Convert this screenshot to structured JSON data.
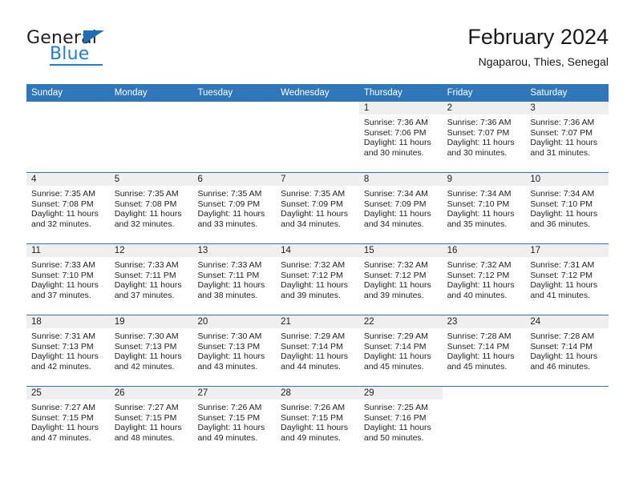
{
  "brand": {
    "name_top": "General",
    "name_bottom": "Blue",
    "accent_color": "#2f76bb",
    "logo_blue": "#1f7fd0"
  },
  "header": {
    "title": "February 2024",
    "subtitle": "Ngaparou, Thies, Senegal"
  },
  "calendar": {
    "weekdays": [
      "Sunday",
      "Monday",
      "Tuesday",
      "Wednesday",
      "Thursday",
      "Friday",
      "Saturday"
    ],
    "weeks": [
      [
        {
          "date": "",
          "blank": true,
          "sunrise": "",
          "sunset": "",
          "daylight_line1": "",
          "daylight_line2": ""
        },
        {
          "date": "",
          "blank": true,
          "sunrise": "",
          "sunset": "",
          "daylight_line1": "",
          "daylight_line2": ""
        },
        {
          "date": "",
          "blank": true,
          "sunrise": "",
          "sunset": "",
          "daylight_line1": "",
          "daylight_line2": ""
        },
        {
          "date": "",
          "blank": true,
          "sunrise": "",
          "sunset": "",
          "daylight_line1": "",
          "daylight_line2": ""
        },
        {
          "date": "1",
          "sunrise": "Sunrise: 7:36 AM",
          "sunset": "Sunset: 7:06 PM",
          "daylight_line1": "Daylight: 11 hours",
          "daylight_line2": "and 30 minutes."
        },
        {
          "date": "2",
          "sunrise": "Sunrise: 7:36 AM",
          "sunset": "Sunset: 7:07 PM",
          "daylight_line1": "Daylight: 11 hours",
          "daylight_line2": "and 30 minutes."
        },
        {
          "date": "3",
          "sunrise": "Sunrise: 7:36 AM",
          "sunset": "Sunset: 7:07 PM",
          "daylight_line1": "Daylight: 11 hours",
          "daylight_line2": "and 31 minutes."
        }
      ],
      [
        {
          "date": "4",
          "sunrise": "Sunrise: 7:35 AM",
          "sunset": "Sunset: 7:08 PM",
          "daylight_line1": "Daylight: 11 hours",
          "daylight_line2": "and 32 minutes."
        },
        {
          "date": "5",
          "sunrise": "Sunrise: 7:35 AM",
          "sunset": "Sunset: 7:08 PM",
          "daylight_line1": "Daylight: 11 hours",
          "daylight_line2": "and 32 minutes."
        },
        {
          "date": "6",
          "sunrise": "Sunrise: 7:35 AM",
          "sunset": "Sunset: 7:09 PM",
          "daylight_line1": "Daylight: 11 hours",
          "daylight_line2": "and 33 minutes."
        },
        {
          "date": "7",
          "sunrise": "Sunrise: 7:35 AM",
          "sunset": "Sunset: 7:09 PM",
          "daylight_line1": "Daylight: 11 hours",
          "daylight_line2": "and 34 minutes."
        },
        {
          "date": "8",
          "sunrise": "Sunrise: 7:34 AM",
          "sunset": "Sunset: 7:09 PM",
          "daylight_line1": "Daylight: 11 hours",
          "daylight_line2": "and 34 minutes."
        },
        {
          "date": "9",
          "sunrise": "Sunrise: 7:34 AM",
          "sunset": "Sunset: 7:10 PM",
          "daylight_line1": "Daylight: 11 hours",
          "daylight_line2": "and 35 minutes."
        },
        {
          "date": "10",
          "sunrise": "Sunrise: 7:34 AM",
          "sunset": "Sunset: 7:10 PM",
          "daylight_line1": "Daylight: 11 hours",
          "daylight_line2": "and 36 minutes."
        }
      ],
      [
        {
          "date": "11",
          "sunrise": "Sunrise: 7:33 AM",
          "sunset": "Sunset: 7:10 PM",
          "daylight_line1": "Daylight: 11 hours",
          "daylight_line2": "and 37 minutes."
        },
        {
          "date": "12",
          "sunrise": "Sunrise: 7:33 AM",
          "sunset": "Sunset: 7:11 PM",
          "daylight_line1": "Daylight: 11 hours",
          "daylight_line2": "and 37 minutes."
        },
        {
          "date": "13",
          "sunrise": "Sunrise: 7:33 AM",
          "sunset": "Sunset: 7:11 PM",
          "daylight_line1": "Daylight: 11 hours",
          "daylight_line2": "and 38 minutes."
        },
        {
          "date": "14",
          "sunrise": "Sunrise: 7:32 AM",
          "sunset": "Sunset: 7:12 PM",
          "daylight_line1": "Daylight: 11 hours",
          "daylight_line2": "and 39 minutes."
        },
        {
          "date": "15",
          "sunrise": "Sunrise: 7:32 AM",
          "sunset": "Sunset: 7:12 PM",
          "daylight_line1": "Daylight: 11 hours",
          "daylight_line2": "and 39 minutes."
        },
        {
          "date": "16",
          "sunrise": "Sunrise: 7:32 AM",
          "sunset": "Sunset: 7:12 PM",
          "daylight_line1": "Daylight: 11 hours",
          "daylight_line2": "and 40 minutes."
        },
        {
          "date": "17",
          "sunrise": "Sunrise: 7:31 AM",
          "sunset": "Sunset: 7:12 PM",
          "daylight_line1": "Daylight: 11 hours",
          "daylight_line2": "and 41 minutes."
        }
      ],
      [
        {
          "date": "18",
          "sunrise": "Sunrise: 7:31 AM",
          "sunset": "Sunset: 7:13 PM",
          "daylight_line1": "Daylight: 11 hours",
          "daylight_line2": "and 42 minutes."
        },
        {
          "date": "19",
          "sunrise": "Sunrise: 7:30 AM",
          "sunset": "Sunset: 7:13 PM",
          "daylight_line1": "Daylight: 11 hours",
          "daylight_line2": "and 42 minutes."
        },
        {
          "date": "20",
          "sunrise": "Sunrise: 7:30 AM",
          "sunset": "Sunset: 7:13 PM",
          "daylight_line1": "Daylight: 11 hours",
          "daylight_line2": "and 43 minutes."
        },
        {
          "date": "21",
          "sunrise": "Sunrise: 7:29 AM",
          "sunset": "Sunset: 7:14 PM",
          "daylight_line1": "Daylight: 11 hours",
          "daylight_line2": "and 44 minutes."
        },
        {
          "date": "22",
          "sunrise": "Sunrise: 7:29 AM",
          "sunset": "Sunset: 7:14 PM",
          "daylight_line1": "Daylight: 11 hours",
          "daylight_line2": "and 45 minutes."
        },
        {
          "date": "23",
          "sunrise": "Sunrise: 7:28 AM",
          "sunset": "Sunset: 7:14 PM",
          "daylight_line1": "Daylight: 11 hours",
          "daylight_line2": "and 45 minutes."
        },
        {
          "date": "24",
          "sunrise": "Sunrise: 7:28 AM",
          "sunset": "Sunset: 7:14 PM",
          "daylight_line1": "Daylight: 11 hours",
          "daylight_line2": "and 46 minutes."
        }
      ],
      [
        {
          "date": "25",
          "sunrise": "Sunrise: 7:27 AM",
          "sunset": "Sunset: 7:15 PM",
          "daylight_line1": "Daylight: 11 hours",
          "daylight_line2": "and 47 minutes."
        },
        {
          "date": "26",
          "sunrise": "Sunrise: 7:27 AM",
          "sunset": "Sunset: 7:15 PM",
          "daylight_line1": "Daylight: 11 hours",
          "daylight_line2": "and 48 minutes."
        },
        {
          "date": "27",
          "sunrise": "Sunrise: 7:26 AM",
          "sunset": "Sunset: 7:15 PM",
          "daylight_line1": "Daylight: 11 hours",
          "daylight_line2": "and 49 minutes."
        },
        {
          "date": "28",
          "sunrise": "Sunrise: 7:26 AM",
          "sunset": "Sunset: 7:15 PM",
          "daylight_line1": "Daylight: 11 hours",
          "daylight_line2": "and 49 minutes."
        },
        {
          "date": "29",
          "sunrise": "Sunrise: 7:25 AM",
          "sunset": "Sunset: 7:16 PM",
          "daylight_line1": "Daylight: 11 hours",
          "daylight_line2": "and 50 minutes."
        },
        {
          "date": "",
          "blank": true,
          "sunrise": "",
          "sunset": "",
          "daylight_line1": "",
          "daylight_line2": ""
        },
        {
          "date": "",
          "blank": true,
          "sunrise": "",
          "sunset": "",
          "daylight_line1": "",
          "daylight_line2": ""
        }
      ]
    ]
  }
}
